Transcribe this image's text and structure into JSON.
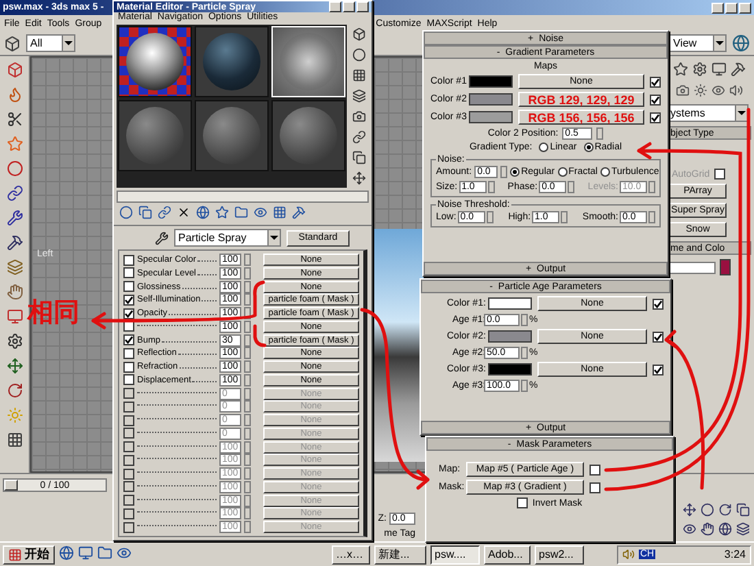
{
  "main_window": {
    "title": "psw.max - 3ds max 5 -",
    "menu": [
      "File",
      "Edit",
      "Tools",
      "Group",
      "Customize",
      "MAXScript",
      "Help"
    ],
    "selection_filter": "All",
    "view_dropdown": "View",
    "viewport_label": "Left",
    "time_slider": {
      "text": "0 / 100",
      "level": 0
    },
    "z_label": "Z:",
    "z_value": "0.0",
    "time_tag": "me Tag"
  },
  "command_panel": {
    "category": "ystems",
    "object_type_heading": "bject Type",
    "autogrid": {
      "label": "AutoGrid",
      "checked": false
    },
    "buttons": [
      "PArray",
      "Super Spray",
      "Snow"
    ],
    "name_color_heading": "me and Colo"
  },
  "material_editor": {
    "title": "Material Editor - Particle Spray",
    "menu": [
      "Material",
      "Navigation",
      "Options",
      "Utilities"
    ],
    "samples": [
      {
        "kind": "foam",
        "selected": false
      },
      {
        "kind": "water",
        "selected": false
      },
      {
        "kind": "box",
        "selected": true
      },
      {
        "kind": "plain",
        "selected": false
      },
      {
        "kind": "plain",
        "selected": false
      },
      {
        "kind": "plain",
        "selected": false
      }
    ],
    "material_name": "Particle Spray",
    "material_type": "Standard",
    "maps": [
      {
        "label": "Specular Color",
        "checked": false,
        "amount": "100",
        "map": "None",
        "enabled": true
      },
      {
        "label": "Specular Level",
        "checked": false,
        "amount": "100",
        "map": "None",
        "enabled": true
      },
      {
        "label": "Glossiness",
        "checked": false,
        "amount": "100",
        "map": "None",
        "enabled": true
      },
      {
        "label": "Self-Illumination",
        "checked": true,
        "amount": "100",
        "map": "particle foam  ( Mask )",
        "enabled": true
      },
      {
        "label": "Opacity",
        "checked": true,
        "amount": "100",
        "map": "particle foam  ( Mask )",
        "enabled": true
      },
      {
        "checked": false,
        "amount": "100",
        "map": "None",
        "enabled": true
      },
      {
        "label": "Bump",
        "checked": true,
        "amount": "30",
        "map": "particle foam  ( Mask )",
        "enabled": true
      },
      {
        "label": "Reflection",
        "checked": false,
        "amount": "100",
        "map": "None",
        "enabled": true
      },
      {
        "label": "Refraction",
        "checked": false,
        "amount": "100",
        "map": "None",
        "enabled": true
      },
      {
        "label": "Displacement",
        "checked": false,
        "amount": "100",
        "map": "None",
        "enabled": true
      },
      {
        "checked": false,
        "amount": "0",
        "map": "None",
        "enabled": false
      },
      {
        "checked": false,
        "amount": "0",
        "map": "None",
        "enabled": false
      },
      {
        "checked": false,
        "amount": "0",
        "map": "None",
        "enabled": false
      },
      {
        "checked": false,
        "amount": "0",
        "map": "None",
        "enabled": false
      },
      {
        "checked": false,
        "amount": "100",
        "map": "None",
        "enabled": false
      },
      {
        "checked": false,
        "amount": "100",
        "map": "None",
        "enabled": false
      },
      {
        "checked": false,
        "amount": "100",
        "map": "None",
        "enabled": false
      },
      {
        "checked": false,
        "amount": "100",
        "map": "None",
        "enabled": false
      },
      {
        "checked": false,
        "amount": "100",
        "map": "None",
        "enabled": false
      },
      {
        "checked": false,
        "amount": "100",
        "map": "None",
        "enabled": false
      },
      {
        "checked": false,
        "amount": "100",
        "map": "None",
        "enabled": false
      }
    ]
  },
  "gradient_panel": {
    "noise_rollout": {
      "sign": "+",
      "title": "Noise"
    },
    "rollout": {
      "sign": "-",
      "title": "Gradient Parameters"
    },
    "maps_heading": "Maps",
    "colors": [
      {
        "label": "Color #1",
        "color": "#000000",
        "map": "None",
        "annotated": false,
        "checked": true
      },
      {
        "label": "Color #2",
        "color": "#8a898e",
        "map": "RGB 129, 129, 129",
        "annotated": true,
        "checked": true
      },
      {
        "label": "Color #3",
        "color": "#9c9c9c",
        "map": "RGB 156, 156, 156",
        "annotated": true,
        "checked": true
      }
    ],
    "position": {
      "label": "Color 2 Position:",
      "value": "0.5"
    },
    "gradient_type": {
      "label": "Gradient Type:",
      "options": [
        {
          "label": "Linear",
          "selected": false
        },
        {
          "label": "Radial",
          "selected": true
        }
      ]
    },
    "noise": {
      "title": "Noise:",
      "amount": {
        "label": "Amount:",
        "value": "0.0"
      },
      "types": [
        {
          "label": "Regular",
          "selected": true
        },
        {
          "label": "Fractal",
          "selected": false
        },
        {
          "label": "Turbulence",
          "selected": false
        }
      ],
      "fields": [
        {
          "label": "Size:",
          "value": "1.0",
          "enabled": true
        },
        {
          "label": "Phase:",
          "value": "0.0",
          "enabled": true
        },
        {
          "label": "Levels:",
          "value": "10.0",
          "enabled": false
        }
      ]
    },
    "threshold": {
      "title": "Noise Threshold:",
      "fields": [
        {
          "label": "Low:",
          "value": "0.0"
        },
        {
          "label": "High:",
          "value": "1.0"
        },
        {
          "label": "Smooth:",
          "value": "0.0"
        }
      ]
    },
    "output_rollout": {
      "sign": "+",
      "title": "Output"
    }
  },
  "particle_age_panel": {
    "rollout": {
      "sign": "-",
      "title": "Particle Age Parameters"
    },
    "colors": [
      {
        "label": "Color #1:",
        "color": "#ffffff",
        "map": "None",
        "checked": true,
        "age_label": "Age #1:",
        "age": "0.0",
        "unit": "%"
      },
      {
        "label": "Color #2:",
        "color": "#8a898e",
        "map": "None",
        "checked": true,
        "age_label": "Age #2:",
        "age": "50.0",
        "unit": "%"
      },
      {
        "label": "Color #3:",
        "color": "#000000",
        "map": "None",
        "checked": true,
        "age_label": "Age #3:",
        "age": "100.0",
        "unit": "%"
      }
    ],
    "output_rollout": {
      "sign": "+",
      "title": "Output"
    }
  },
  "mask_panel": {
    "rollout": {
      "sign": "-",
      "title": "Mask Parameters"
    },
    "map": {
      "label": "Map:",
      "value": "Map #5  ( Particle Age )",
      "checked": false
    },
    "mask": {
      "label": "Mask:",
      "value": "Map #3  ( Gradient )",
      "checked": false
    },
    "invert": {
      "label": "Invert Mask",
      "checked": false
    }
  },
  "annotation": {
    "text": "相同"
  },
  "taskbar": {
    "start": "开始",
    "tasks": [
      {
        "label": "…x…",
        "selected": false
      },
      {
        "label": "新建...",
        "selected": false
      },
      {
        "label": "psw....",
        "selected": true
      },
      {
        "label": "Adob...",
        "selected": false
      },
      {
        "label": "psw2...",
        "selected": false
      }
    ],
    "lang": "CH",
    "clock": "3:24"
  }
}
